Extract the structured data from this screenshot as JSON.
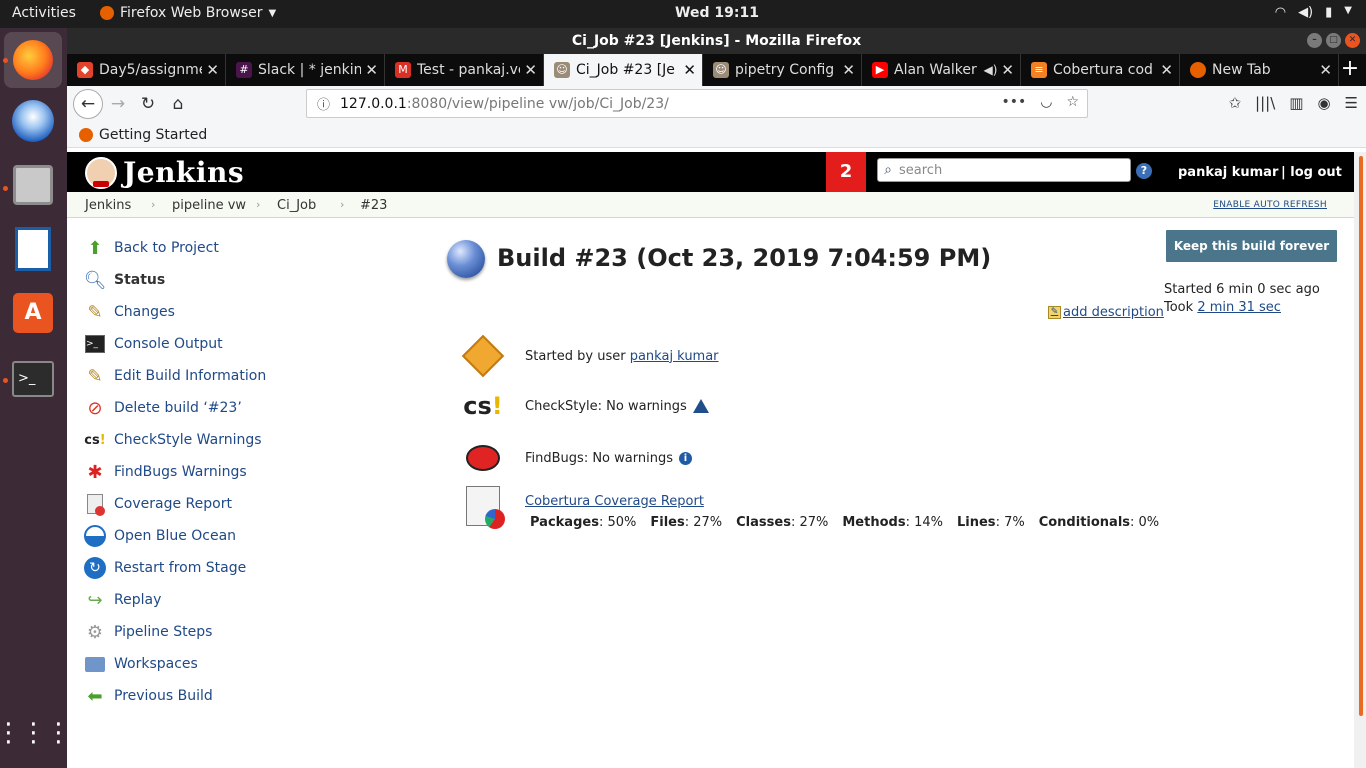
{
  "topbar": {
    "activities": "Activities",
    "app_name": "Firefox Web Browser",
    "clock": "Wed 19:11"
  },
  "window": {
    "title": "Ci_Job #23 [Jenkins] - Mozilla Firefox"
  },
  "tabs": [
    {
      "label": "Day5/assignme",
      "color": "#e2432a"
    },
    {
      "label": "Slack | * jenkins",
      "color": "#4a154b"
    },
    {
      "label": "Test - pankaj.ve",
      "color": "#d93025"
    },
    {
      "label": "Ci_Job #23 [Je",
      "color": "#9b8c78"
    },
    {
      "label": "pipetry Config",
      "color": "#9b8c78"
    },
    {
      "label": "Alan Walker",
      "color": "#ff0000"
    },
    {
      "label": "Cobertura cod",
      "color": "#f48024"
    },
    {
      "label": "New Tab",
      "color": "#e66000"
    }
  ],
  "url": {
    "host": "127.0.0.1",
    "path": ":8080/view/pipeline vw/job/Ci_Job/23/"
  },
  "bookmarks": {
    "getting_started": "Getting Started"
  },
  "jenkins": {
    "logo": "Jenkins",
    "notification_count": "2",
    "search_placeholder": "search",
    "user": "pankaj kumar",
    "logout": "| log out",
    "breadcrumbs": [
      "Jenkins",
      "pipeline vw",
      "Ci_Job",
      "#23"
    ],
    "auto_refresh": "ENABLE AUTO REFRESH"
  },
  "sidebar": [
    {
      "label": "Back to Project",
      "icon": "up-arrow-icon"
    },
    {
      "label": "Status",
      "icon": "magnifier-icon"
    },
    {
      "label": "Changes",
      "icon": "notepad-icon"
    },
    {
      "label": "Console Output",
      "icon": "terminal-icon"
    },
    {
      "label": "Edit Build Information",
      "icon": "notepad-icon"
    },
    {
      "label": "Delete build ‘#23’",
      "icon": "no-entry-icon"
    },
    {
      "label": "CheckStyle Warnings",
      "icon": "checkstyle-icon"
    },
    {
      "label": "FindBugs Warnings",
      "icon": "bug-icon"
    },
    {
      "label": "Coverage Report",
      "icon": "coverage-icon"
    },
    {
      "label": "Open Blue Ocean",
      "icon": "blue-ocean-icon"
    },
    {
      "label": "Restart from Stage",
      "icon": "restart-icon"
    },
    {
      "label": "Replay",
      "icon": "replay-icon"
    },
    {
      "label": "Pipeline Steps",
      "icon": "gear-icon"
    },
    {
      "label": "Workspaces",
      "icon": "folder-icon"
    },
    {
      "label": "Previous Build",
      "icon": "left-arrow-icon"
    }
  ],
  "build": {
    "title": "Build #23 (Oct 23, 2019 7:04:59 PM)",
    "keep_button": "Keep this build forever",
    "started": "Started 6 min 0 sec ago",
    "took_prefix": "Took ",
    "took_value": "2 min 31 sec",
    "add_description": "add description",
    "started_by_prefix": "Started by user ",
    "started_by_user": "pankaj kumar",
    "checkstyle": "CheckStyle: No warnings",
    "findbugs": "FindBugs: No warnings",
    "cobertura_link": "Cobertura Coverage Report",
    "coverage": [
      {
        "name": "Packages",
        "value": ": 50%"
      },
      {
        "name": "Files",
        "value": ": 27%"
      },
      {
        "name": "Classes",
        "value": ": 27%"
      },
      {
        "name": "Methods",
        "value": ": 14%"
      },
      {
        "name": "Lines",
        "value": ": 7%"
      },
      {
        "name": "Conditionals",
        "value": ": 0%"
      }
    ]
  }
}
